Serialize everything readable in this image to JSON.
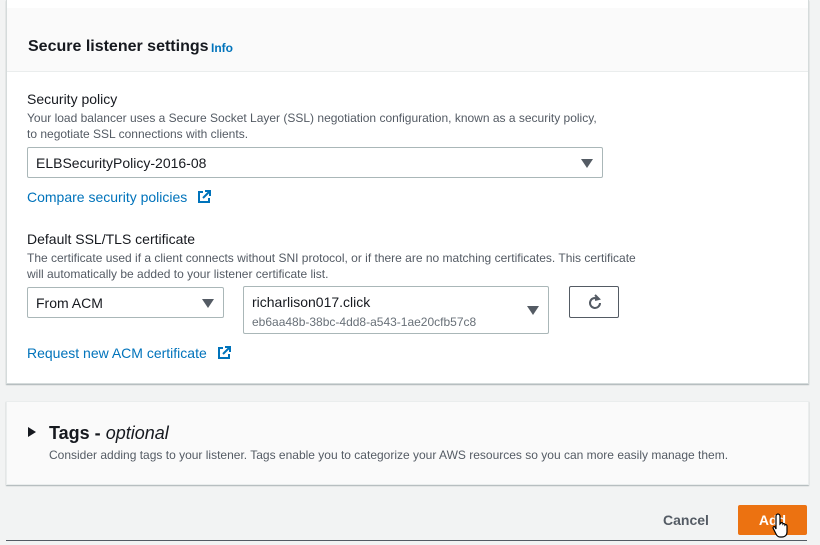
{
  "secure_listener": {
    "title": "Secure listener settings",
    "info_label": "Info",
    "security_policy": {
      "label": "Security policy",
      "description_line1": "Your load balancer uses a Secure Socket Layer (SSL) negotiation configuration, known as a security policy,",
      "description_line2": "to negotiate SSL connections with clients.",
      "selected": "ELBSecurityPolicy-2016-08",
      "compare_link": "Compare security policies"
    },
    "certificate": {
      "label": "Default SSL/TLS certificate",
      "description_line1": "The certificate used if a client connects without SNI protocol, or if there are no matching certificates. This certificate",
      "description_line2": "will automatically be added to your listener certificate list.",
      "source_selected": "From ACM",
      "cert_name": "richarlison017.click",
      "cert_id": "eb6aa48b-38bc-4dd8-a543-1ae20cfb57c8",
      "request_link": "Request new ACM certificate"
    }
  },
  "tags": {
    "title_bold": "Tags -",
    "title_italic": "optional",
    "description": "Consider adding tags to your listener. Tags enable you to categorize your AWS resources so you can more easily manage them."
  },
  "footer": {
    "cancel_label": "Cancel",
    "add_label": "Add"
  },
  "icons": {
    "external": "external-link-icon",
    "refresh": "refresh-icon",
    "dropdown": "caret-down-icon",
    "expand": "caret-right-icon",
    "cursor": "hand-pointer-cursor"
  },
  "colors": {
    "link": "#0073bb",
    "primary_button": "#ec7211",
    "text": "#16191f",
    "secondary_text": "#545b64"
  }
}
